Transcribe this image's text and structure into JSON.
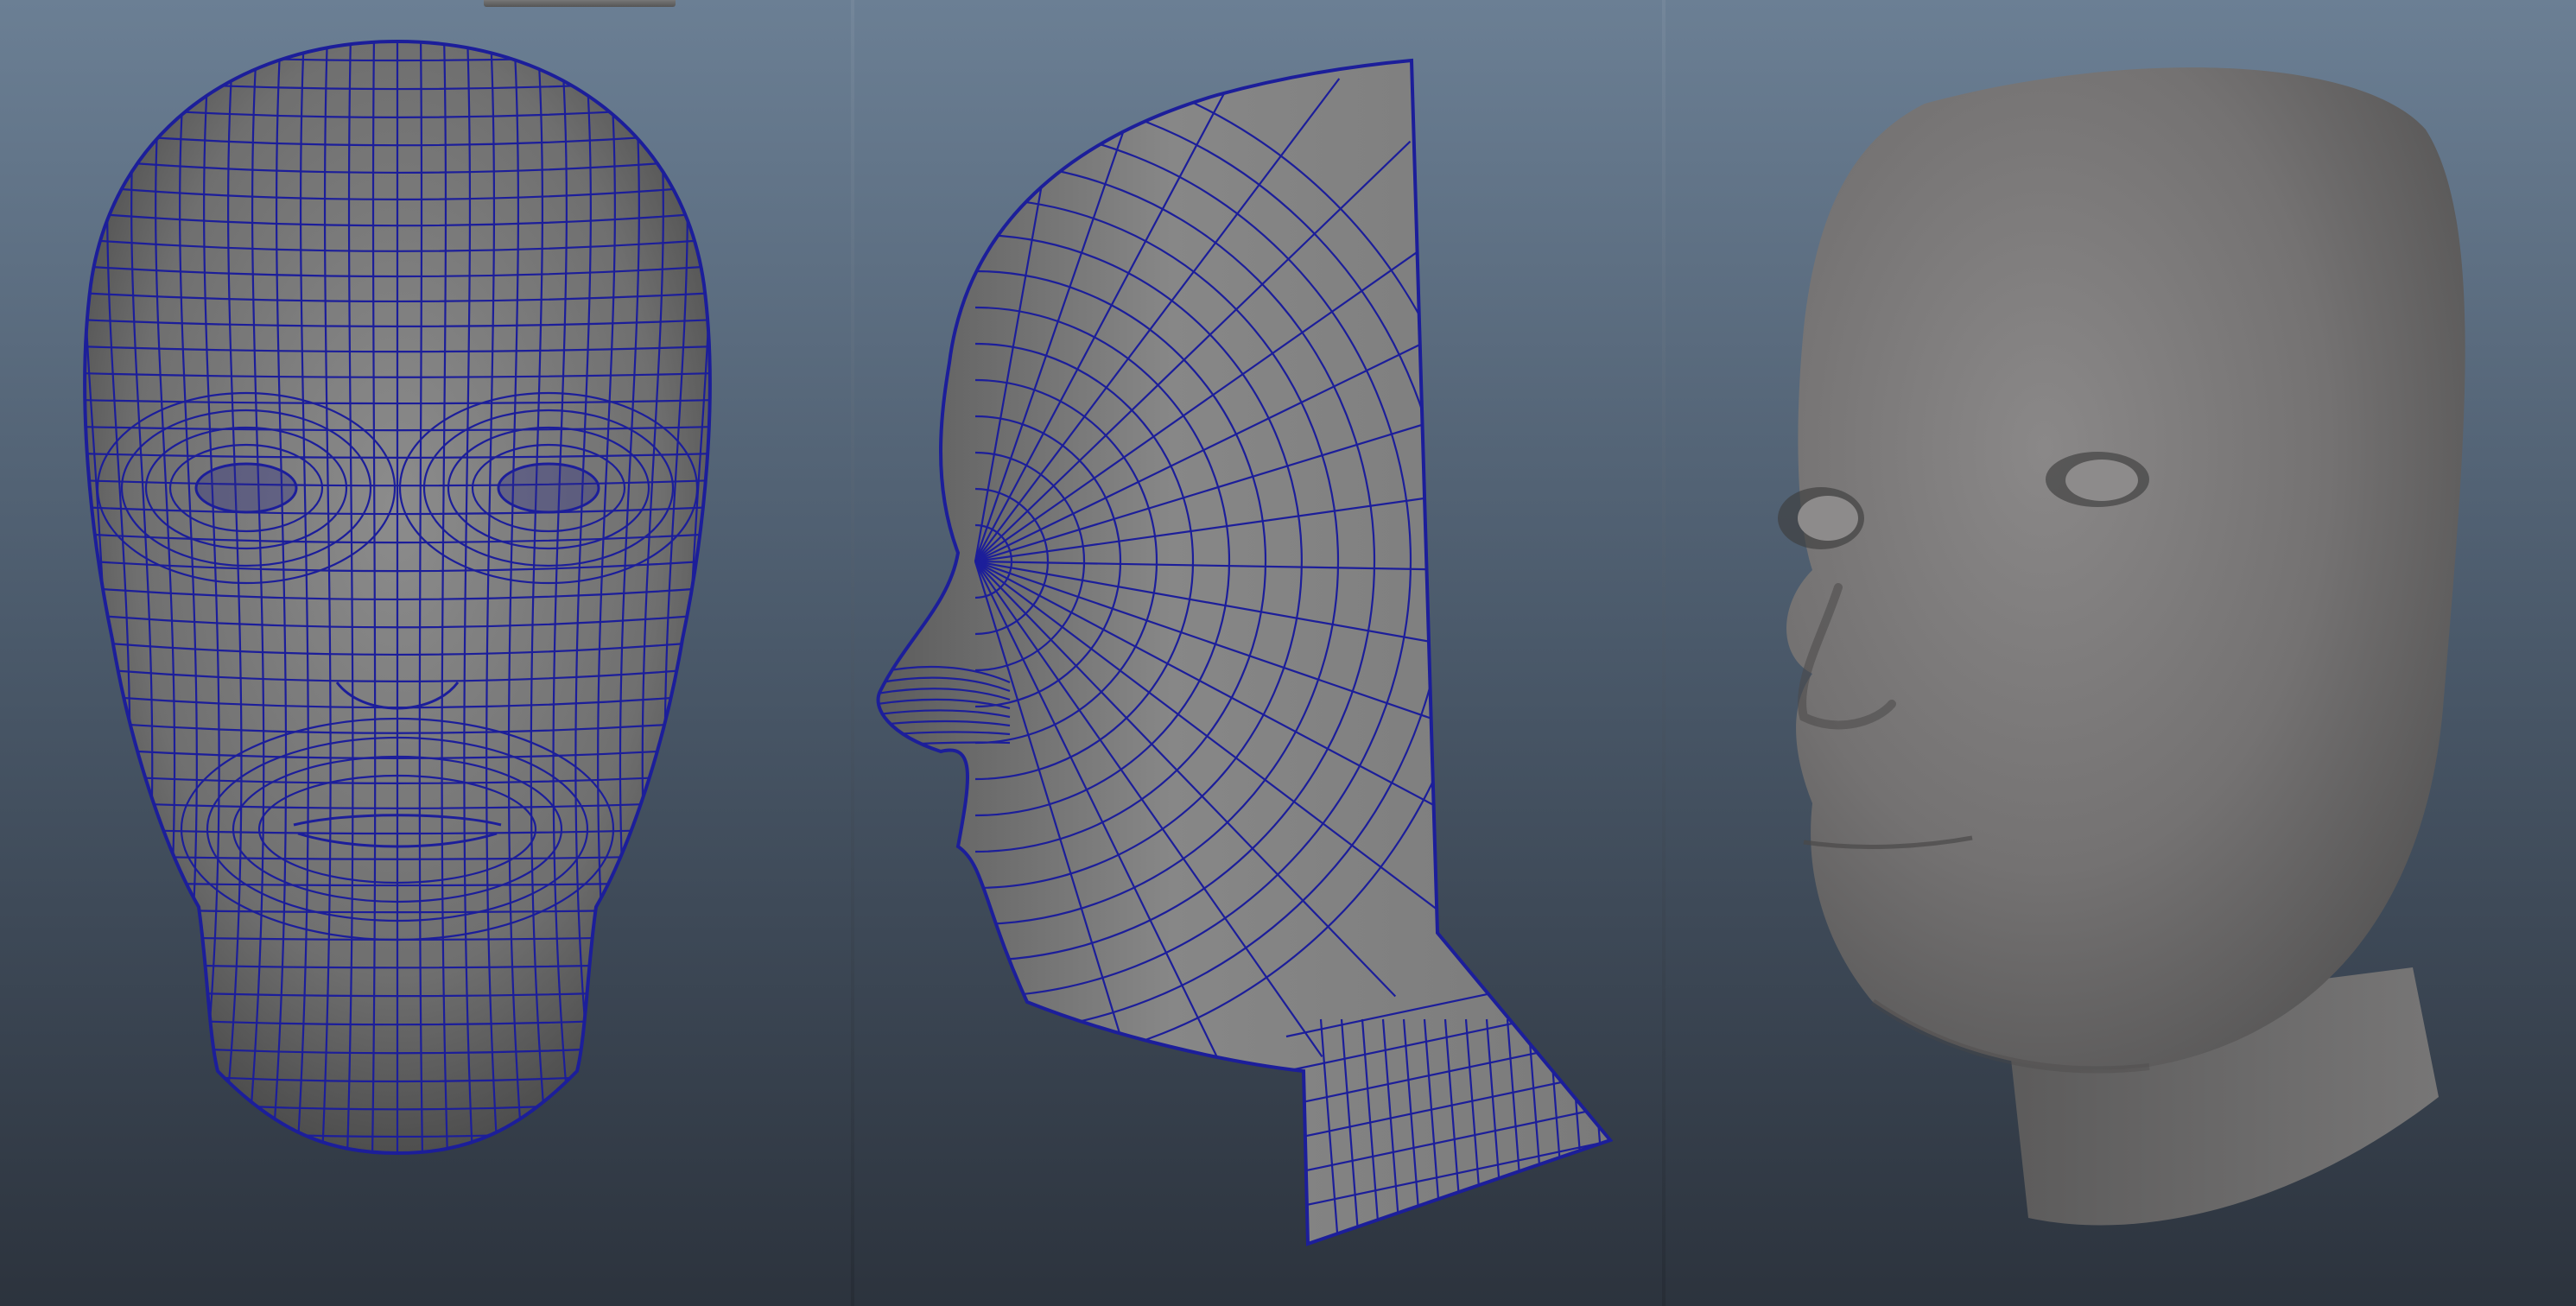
{
  "scene": {
    "viewports": [
      {
        "view": "front",
        "display": "wireframe-on-shaded"
      },
      {
        "view": "side",
        "display": "wireframe-on-shaded"
      },
      {
        "view": "perspective",
        "display": "smooth-shaded"
      }
    ],
    "colors": {
      "background_top": "#6b7f94",
      "background_bottom": "#2c333d",
      "mesh_surface": "#7a7a7a",
      "wireframe": "#1c1e9a"
    },
    "icons": [
      "head-mesh-front",
      "head-mesh-side",
      "head-mesh-shaded"
    ]
  }
}
